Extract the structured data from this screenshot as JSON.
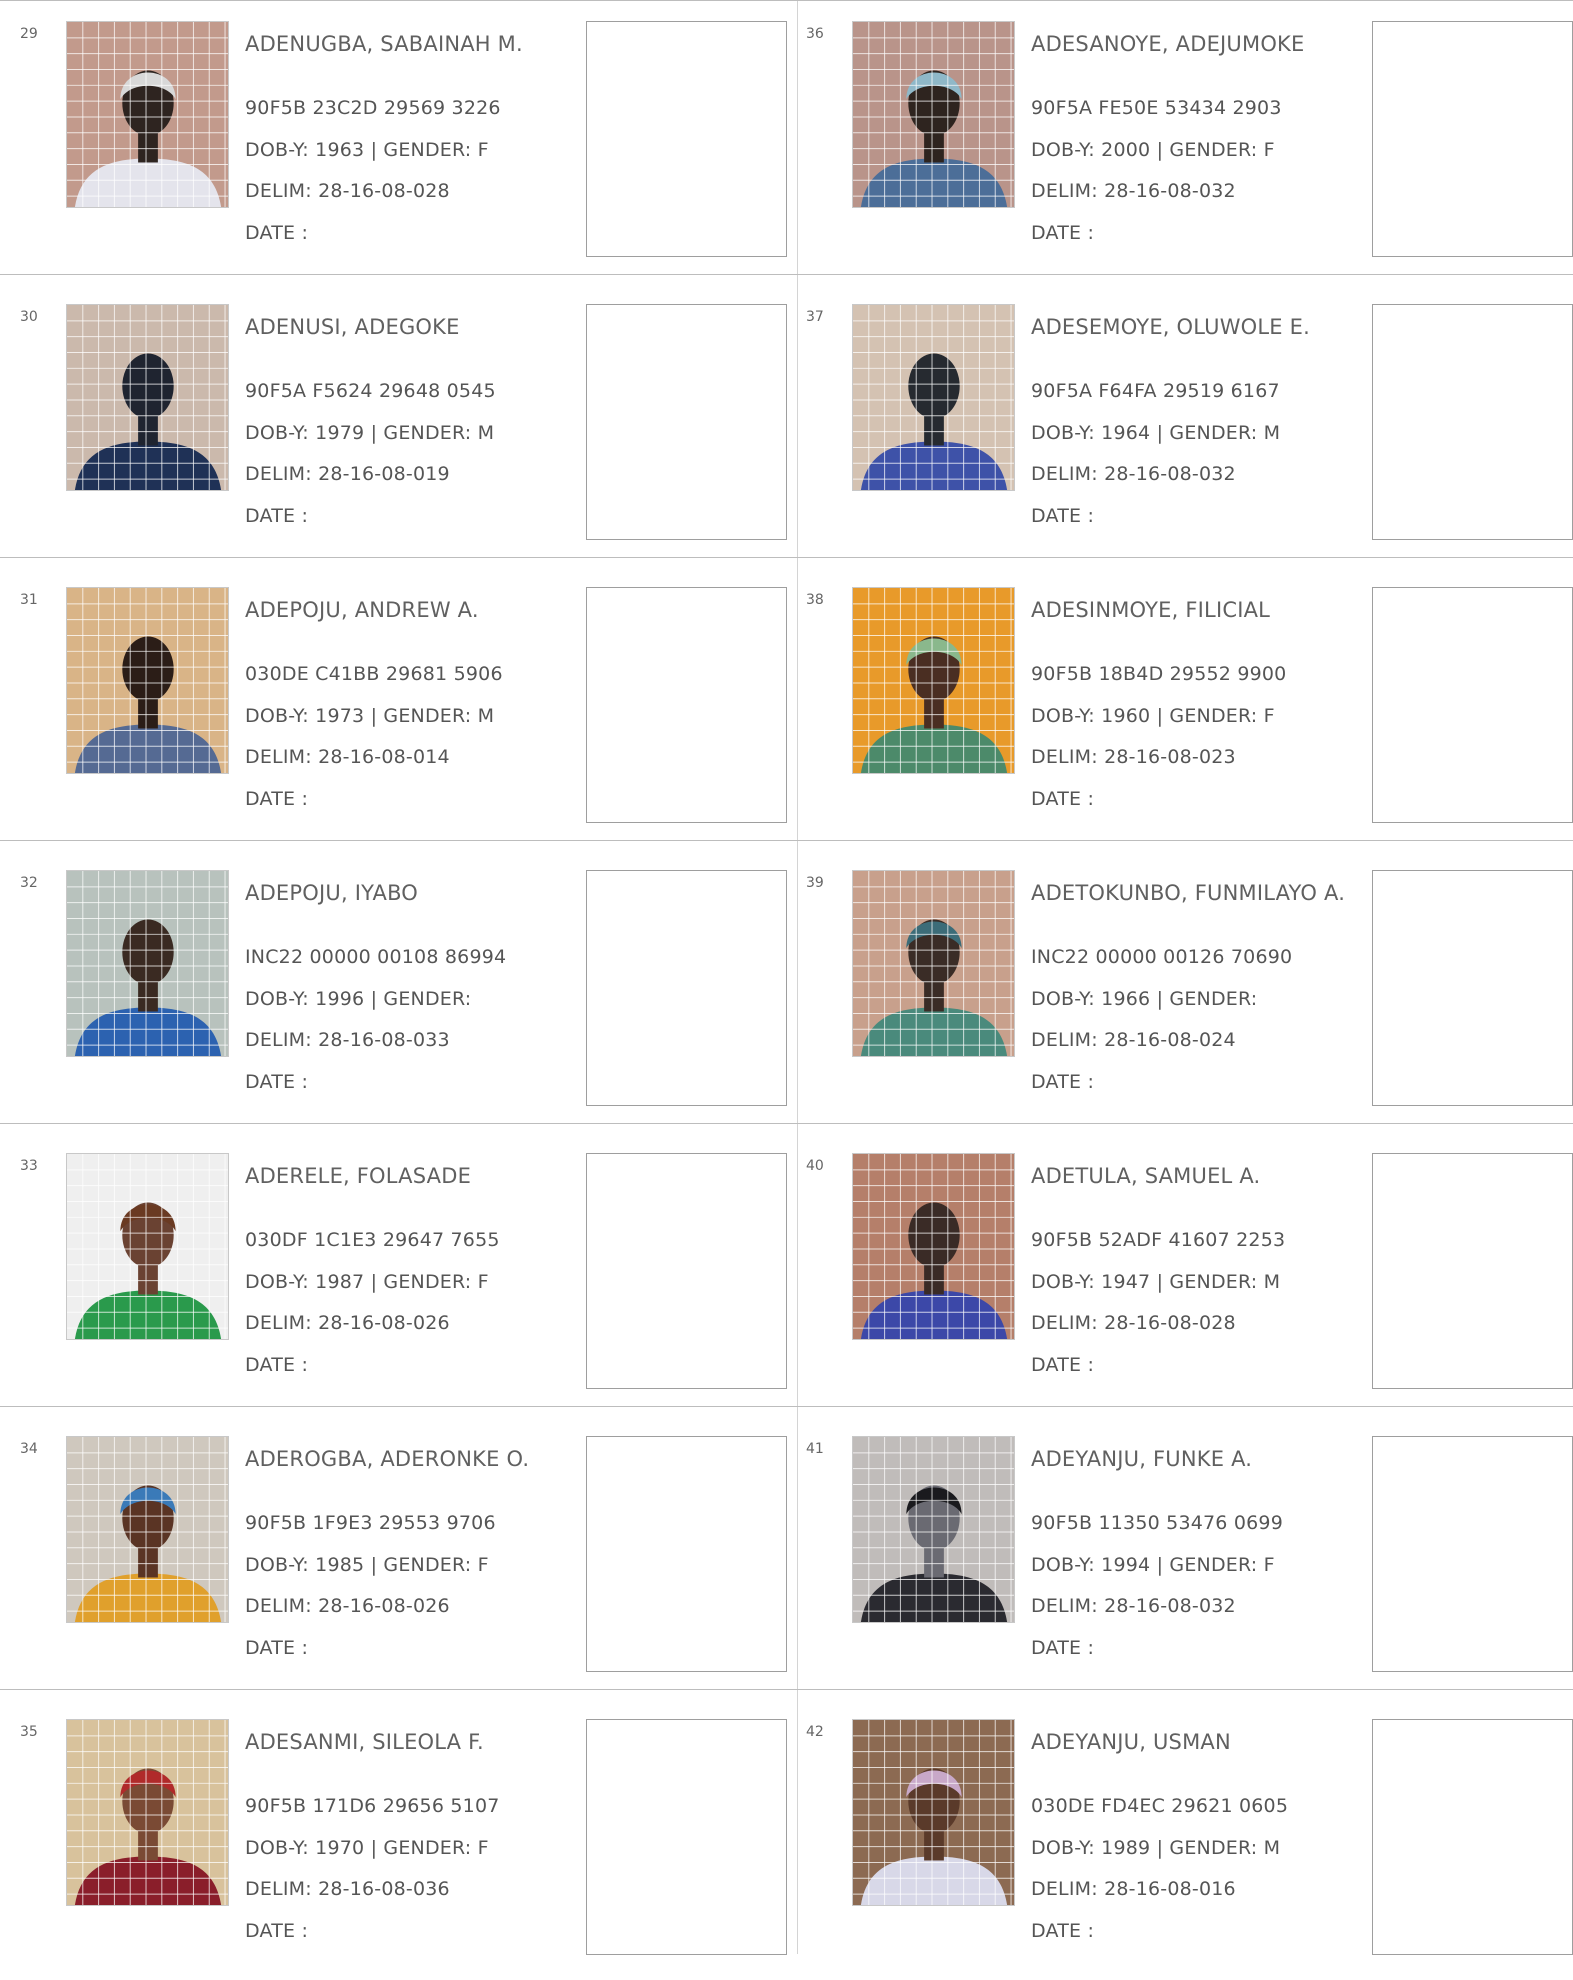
{
  "labels": {
    "dob": "DOB-Y:",
    "gender": "| GENDER:",
    "delim": "DELIM:",
    "date": "DATE :"
  },
  "colors": {
    "grid_line": "#ffffff",
    "border": "#bdbdbd",
    "text": "#555555"
  },
  "records": [
    {
      "num": "29",
      "name": "ADENUGBA, SABAINAH M.",
      "vin": "90F5B 23C2D 29569 3226",
      "dob": "1963",
      "gender": "F",
      "delim": "28-16-08-028",
      "photo": {
        "bg": "#c29a8c",
        "skin": "#2e2420",
        "cloth": "#e4e4ec",
        "head": "#d8d8d8"
      }
    },
    {
      "num": "30",
      "name": "ADENUSI, ADEGOKE",
      "vin": "90F5A F5624 29648 0545",
      "dob": "1979",
      "gender": "M",
      "delim": "28-16-08-019",
      "photo": {
        "bg": "#cbb9ac",
        "skin": "#1f2430",
        "cloth": "#1f3156",
        "head": ""
      }
    },
    {
      "num": "31",
      "name": "ADEPOJU, ANDREW A.",
      "vin": "030DE C41BB 29681 5906",
      "dob": "1973",
      "gender": "M",
      "delim": "28-16-08-014",
      "photo": {
        "bg": "#d9b487",
        "skin": "#2b1d17",
        "cloth": "#556a93",
        "head": ""
      }
    },
    {
      "num": "32",
      "name": "ADEPOJU, IYABO",
      "vin": "INC22 00000 00108 86994",
      "dob": "1996",
      "gender": "",
      "delim": "28-16-08-033",
      "photo": {
        "bg": "#b8c2bd",
        "skin": "#3a2a22",
        "cloth": "#2c62b0",
        "head": ""
      }
    },
    {
      "num": "33",
      "name": "ADERELE, FOLASADE",
      "vin": "030DF 1C1E3 29647 7655",
      "dob": "1987",
      "gender": "F",
      "delim": "28-16-08-026",
      "photo": {
        "bg": "#efefef",
        "skin": "#6a4232",
        "cloth": "#2a9a4c",
        "head": "#6a3a22"
      }
    },
    {
      "num": "34",
      "name": "ADEROGBA, ADERONKE O.",
      "vin": "90F5B 1F9E3 29553 9706",
      "dob": "1985",
      "gender": "F",
      "delim": "28-16-08-026",
      "photo": {
        "bg": "#cfc8be",
        "skin": "#5a3424",
        "cloth": "#e0a02c",
        "head": "#3a7ab8"
      }
    },
    {
      "num": "35",
      "name": "ADESANMI, SILEOLA F.",
      "vin": "90F5B 171D6 29656 5107",
      "dob": "1970",
      "gender": "F",
      "delim": "28-16-08-036",
      "photo": {
        "bg": "#d8c29c",
        "skin": "#7a4a34",
        "cloth": "#8a1e2a",
        "head": "#b02a2a"
      }
    },
    {
      "num": "36",
      "name": "ADESANOYE, ADEJUMOKE",
      "vin": "90F5A FE50E 53434 2903",
      "dob": "2000",
      "gender": "F",
      "delim": "28-16-08-032",
      "photo": {
        "bg": "#b9948a",
        "skin": "#2e241f",
        "cloth": "#4c6e98",
        "head": "#8fb8c8"
      }
    },
    {
      "num": "37",
      "name": "ADESEMOYE, OLUWOLE E.",
      "vin": "90F5A F64FA 29519 6167",
      "dob": "1964",
      "gender": "M",
      "delim": "28-16-08-032",
      "photo": {
        "bg": "#d4c2b2",
        "skin": "#262a30",
        "cloth": "#3e52a8",
        "head": ""
      }
    },
    {
      "num": "38",
      "name": "ADESINMOYE, FILICIAL",
      "vin": "90F5B 18B4D 29552 9900",
      "dob": "1960",
      "gender": "F",
      "delim": "28-16-08-023",
      "photo": {
        "bg": "#e89a2a",
        "skin": "#4a2e22",
        "cloth": "#4c8a6a",
        "head": "#8ab88c"
      }
    },
    {
      "num": "39",
      "name": "ADETOKUNBO, FUNMILAYO A.",
      "vin": "INC22 00000 00126 70690",
      "dob": "1966",
      "gender": "",
      "delim": "28-16-08-024",
      "photo": {
        "bg": "#c8a08c",
        "skin": "#3a2c26",
        "cloth": "#4a8a7c",
        "head": "#3c6c78"
      }
    },
    {
      "num": "40",
      "name": "ADETULA, SAMUEL A.",
      "vin": "90F5B 52ADF 41607 2253",
      "dob": "1947",
      "gender": "M",
      "delim": "28-16-08-028",
      "photo": {
        "bg": "#b57f6a",
        "skin": "#3a2b26",
        "cloth": "#3c48a8",
        "head": ""
      }
    },
    {
      "num": "41",
      "name": "ADEYANJU, FUNKE A.",
      "vin": "90F5B 11350 53476 0699",
      "dob": "1994",
      "gender": "F",
      "delim": "28-16-08-032",
      "photo": {
        "bg": "#c0bcba",
        "skin": "#6a6a72",
        "cloth": "#2a2a30",
        "head": "#1a1a1e"
      }
    },
    {
      "num": "42",
      "name": "ADEYANJU, USMAN",
      "vin": "030DE FD4EC 29621 0605",
      "dob": "1989",
      "gender": "M",
      "delim": "28-16-08-016",
      "photo": {
        "bg": "#8c6a52",
        "skin": "#5a3a2a",
        "cloth": "#d8d8e8",
        "head": "#c8a8c8"
      }
    }
  ]
}
